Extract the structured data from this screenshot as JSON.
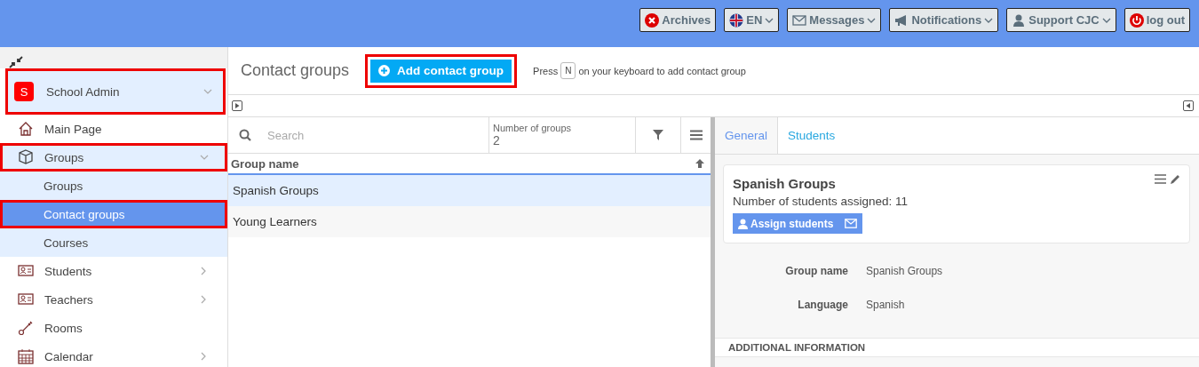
{
  "topbar": {
    "buttons": [
      {
        "label": "Archives",
        "dropdown": false
      },
      {
        "label": "EN",
        "dropdown": true
      },
      {
        "label": "Messages",
        "dropdown": true
      },
      {
        "label": "Notifications",
        "dropdown": true
      },
      {
        "label": "Support CJC",
        "dropdown": true
      },
      {
        "label": "log out",
        "dropdown": false
      }
    ]
  },
  "sidebar": {
    "profile": {
      "avatar": "S",
      "name": "School Admin",
      "highlighted": true
    },
    "items": [
      {
        "label": "Main Page",
        "highlighted": false
      },
      {
        "label": "Groups",
        "expanded": true,
        "highlighted": true,
        "children": [
          {
            "label": "Groups",
            "selected": false,
            "highlighted": false
          },
          {
            "label": "Contact groups",
            "selected": true,
            "highlighted": true
          },
          {
            "label": "Courses",
            "selected": false,
            "highlighted": false
          }
        ]
      },
      {
        "label": "Students",
        "expanded": false,
        "highlighted": false
      },
      {
        "label": "Teachers",
        "expanded": false,
        "highlighted": false
      },
      {
        "label": "Rooms",
        "highlighted": false
      },
      {
        "label": "Calendar",
        "expanded": false,
        "highlighted": false
      }
    ]
  },
  "header": {
    "title": "Contact groups",
    "add_button": {
      "label": "Add contact group",
      "highlighted": true
    },
    "hint_before": "Press",
    "hint_key": "N",
    "hint_after": "on your keyboard to add contact group"
  },
  "list": {
    "search": {
      "placeholder": "Search"
    },
    "count_label": "Number of groups",
    "count": "2",
    "column": "Group name",
    "rows": [
      {
        "name": "Spanish Groups",
        "selected": true
      },
      {
        "name": "Young Learners",
        "selected": false
      }
    ]
  },
  "detail": {
    "tabs": [
      {
        "label": "General",
        "selected": true
      },
      {
        "label": "Students",
        "selected": false
      }
    ],
    "card": {
      "title": "Spanish Groups",
      "subtitle": "Number of students assigned: 11",
      "button": "Assign students"
    },
    "fields": [
      {
        "label": "Group name",
        "value": "Spanish Groups"
      },
      {
        "label": "Language",
        "value": "Spanish"
      }
    ],
    "section": "ADDITIONAL INFORMATION"
  }
}
